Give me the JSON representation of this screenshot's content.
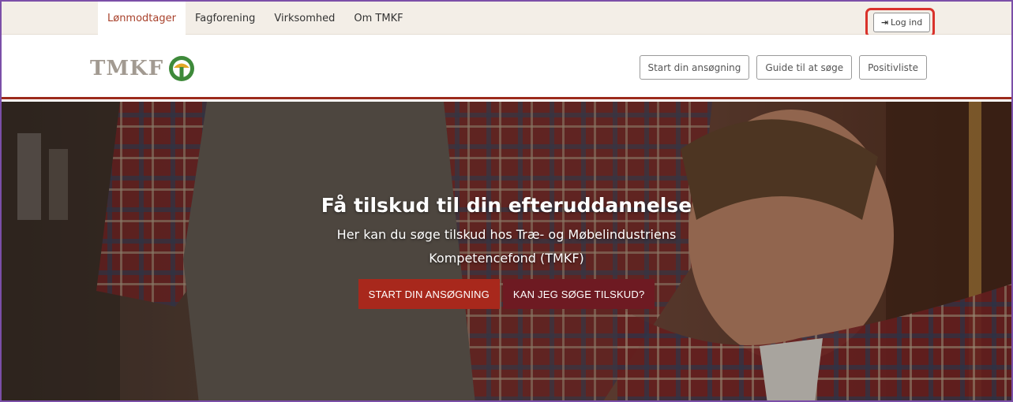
{
  "topnav": {
    "items": [
      {
        "label": "Lønmodtager",
        "active": true
      },
      {
        "label": "Fagforening",
        "active": false
      },
      {
        "label": "Virksomhed",
        "active": false
      },
      {
        "label": "Om TMKF",
        "active": false
      }
    ],
    "login_label": "Log ind",
    "login_icon": "sign-in-icon"
  },
  "header": {
    "logo_text": "TMKF",
    "buttons": {
      "start": "Start din ansøgning",
      "guide": "Guide til at søge",
      "positive": "Positivliste"
    }
  },
  "hero": {
    "title": "Få tilskud til din efteruddannelse",
    "subtitle": "Her kan du søge tilskud hos Træ- og Møbelindustriens Kompetencefond (TMKF)",
    "primary_button": "START DIN ANSØGNING",
    "secondary_button": "KAN JEG SØGE TILSKUD?"
  },
  "colors": {
    "accent": "#a8412b",
    "brand_red": "#9c2a1c",
    "primary_button": "#a8281c",
    "secondary_button": "#6e1a22",
    "topbar_bg": "#f3eee7",
    "highlight": "#d9322b"
  }
}
